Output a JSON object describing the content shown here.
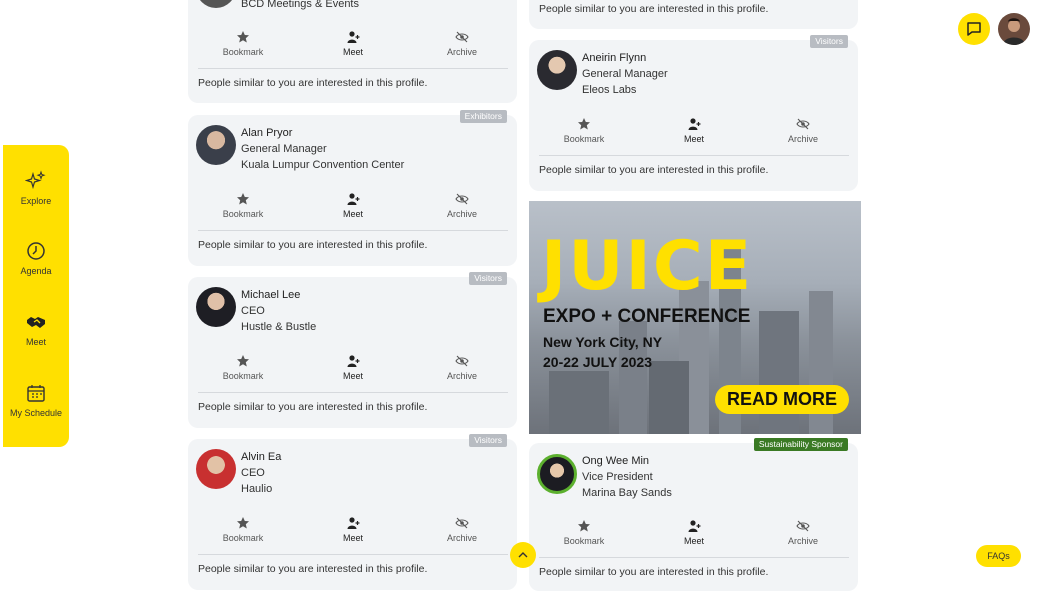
{
  "rail": {
    "items": [
      {
        "label": "Explore",
        "icon": "sparkles-icon"
      },
      {
        "label": "Agenda",
        "icon": "clock-icon"
      },
      {
        "label": "Meet",
        "icon": "handshake-icon"
      },
      {
        "label": "My Schedule",
        "icon": "calendar-icon"
      }
    ]
  },
  "actions": {
    "bookmark": "Bookmark",
    "meet": "Meet",
    "archive": "Archive"
  },
  "note": "People similar to you are interested in this profile.",
  "cards": [
    {
      "company": "BCD Meetings & Events"
    },
    {
      "badge": "Exhibitors",
      "name": "Alan Pryor",
      "title": "General Manager",
      "company": "Kuala Lumpur Convention Center"
    },
    {
      "badge": "Visitors",
      "name": "Michael Lee",
      "title": "CEO",
      "company": "Hustle & Bustle"
    },
    {
      "badge": "Visitors",
      "name": "Alvin Ea",
      "title": "CEO",
      "company": "Haulio"
    },
    {
      "badge": "Visitors",
      "name": "Aneirin Flynn",
      "title": "General Manager",
      "company": "Eleos Labs"
    },
    {
      "badge": "Sustainability Sponsor",
      "name": "Ong Wee Min",
      "title": "Vice President",
      "company": "Marina Bay Sands"
    }
  ],
  "banner": {
    "headline": "JUICE",
    "subtitle": "EXPO + CONFERENCE",
    "city": "New York City, NY",
    "dates": "20-22 JULY 2023",
    "cta": "READ MORE"
  },
  "faq_label": "FAQs",
  "colors": {
    "accent": "#ffe000",
    "card_bg": "#f2f4f6",
    "badge_grey": "#b8bcc2",
    "badge_green": "#3a7a24"
  }
}
